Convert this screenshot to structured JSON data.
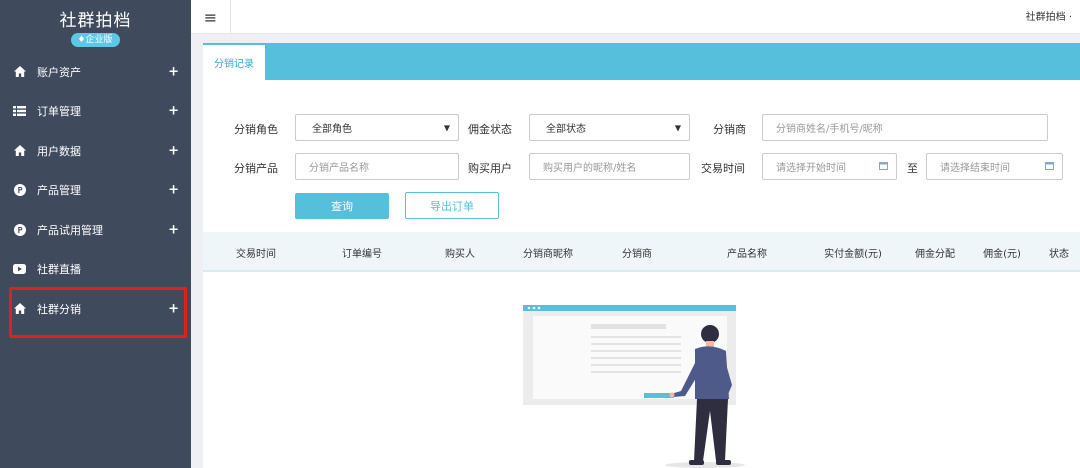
{
  "sidebar": {
    "title": "社群拍档",
    "badge": "企业版",
    "items": [
      {
        "label": "账户资产",
        "icon": "home-icon",
        "expand": "+"
      },
      {
        "label": "订单管理",
        "icon": "list-icon",
        "expand": "+"
      },
      {
        "label": "用户数据",
        "icon": "home-icon",
        "expand": "+"
      },
      {
        "label": "产品管理",
        "icon": "p-circle-icon",
        "expand": "+"
      },
      {
        "label": "产品试用管理",
        "icon": "p-circle-icon",
        "expand": "+"
      },
      {
        "label": "社群直播",
        "icon": "video-icon",
        "expand": ""
      },
      {
        "label": "社群分销",
        "icon": "home-icon",
        "expand": "+"
      }
    ]
  },
  "topbar": {
    "menu_icon": "≡",
    "user": "社群拍档 ·"
  },
  "tabs": [
    {
      "label": "分销记录",
      "active": true
    }
  ],
  "filters": {
    "role_label": "分销角色",
    "role_value": "全部角色",
    "commission_label": "佣金状态",
    "commission_value": "全部状态",
    "distributor_label": "分销商",
    "distributor_placeholder": "分销商姓名/手机号/昵称",
    "product_label": "分销产品",
    "product_placeholder": "分销产品名称",
    "buyer_label": "购买用户",
    "buyer_placeholder": "购买用户的昵称/姓名",
    "time_label": "交易时间",
    "start_placeholder": "请选择开始时间",
    "to_label": "至",
    "end_placeholder": "请选择结束时间",
    "query_button": "查询",
    "export_button": "导出订单"
  },
  "table": {
    "columns": [
      "交易时间",
      "订单编号",
      "购买人",
      "分销商昵称",
      "分销商",
      "产品名称",
      "实付金额(元)",
      "佣金分配",
      "佣金(元)",
      "状态"
    ]
  },
  "colors": {
    "sidebar_bg": "#3f4a5c",
    "accent": "#56bfdc",
    "highlight": "#e02020"
  }
}
